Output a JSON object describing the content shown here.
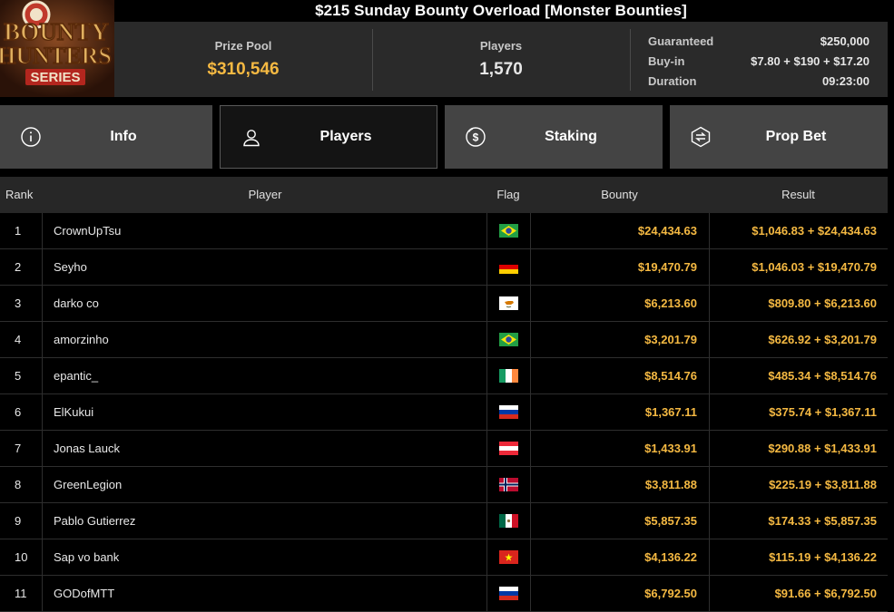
{
  "logo": {
    "line1": "BOUNTY",
    "line2": "HUNTERS",
    "line3": "SERIES"
  },
  "title": "$215 Sunday Bounty Overload [Monster Bounties]",
  "stats": {
    "prize_pool_label": "Prize Pool",
    "prize_pool_value": "$310,546",
    "players_label": "Players",
    "players_value": "1,570"
  },
  "details": [
    {
      "label": "Guaranteed",
      "value": "$250,000"
    },
    {
      "label": "Buy-in",
      "value": "$7.80 + $190 + $17.20"
    },
    {
      "label": "Duration",
      "value": "09:23:00"
    }
  ],
  "tabs": [
    {
      "label": "Info",
      "icon": "info-icon"
    },
    {
      "label": "Players",
      "icon": "user-icon",
      "active": true
    },
    {
      "label": "Staking",
      "icon": "dollar-coin-icon"
    },
    {
      "label": "Prop Bet",
      "icon": "bet-icon"
    }
  ],
  "table": {
    "headers": {
      "rank": "Rank",
      "player": "Player",
      "flag": "Flag",
      "bounty": "Bounty",
      "result": "Result"
    },
    "rows": [
      {
        "rank": "1",
        "player": "CrownUpTsu",
        "flag": "brazil",
        "bounty": "$24,434.63",
        "result": "$1,046.83 + $24,434.63"
      },
      {
        "rank": "2",
        "player": "Seyho",
        "flag": "germany",
        "bounty": "$19,470.79",
        "result": "$1,046.03 + $19,470.79"
      },
      {
        "rank": "3",
        "player": "darko co",
        "flag": "cyprus",
        "bounty": "$6,213.60",
        "result": "$809.80 + $6,213.60"
      },
      {
        "rank": "4",
        "player": "amorzinho",
        "flag": "brazil",
        "bounty": "$3,201.79",
        "result": "$626.92 + $3,201.79"
      },
      {
        "rank": "5",
        "player": "epantic_",
        "flag": "ireland",
        "bounty": "$8,514.76",
        "result": "$485.34 + $8,514.76"
      },
      {
        "rank": "6",
        "player": "ElKukui",
        "flag": "russia",
        "bounty": "$1,367.11",
        "result": "$375.74 + $1,367.11"
      },
      {
        "rank": "7",
        "player": "Jonas Lauck",
        "flag": "austria",
        "bounty": "$1,433.91",
        "result": "$290.88 + $1,433.91"
      },
      {
        "rank": "8",
        "player": "GreenLegion",
        "flag": "norway",
        "bounty": "$3,811.88",
        "result": "$225.19 + $3,811.88"
      },
      {
        "rank": "9",
        "player": "Pablo Gutierrez",
        "flag": "mexico",
        "bounty": "$5,857.35",
        "result": "$174.33 + $5,857.35"
      },
      {
        "rank": "10",
        "player": "Sap vo bank",
        "flag": "vietnam",
        "bounty": "$4,136.22",
        "result": "$115.19 + $4,136.22"
      },
      {
        "rank": "11",
        "player": "GODofMTT",
        "flag": "russia",
        "bounty": "$6,792.50",
        "result": "$91.66 + $6,792.50"
      }
    ]
  },
  "colors": {
    "gold": "#f5b942",
    "tab_bg": "#444444",
    "tab_active_bg": "#141414",
    "strip_bg": "#2a2a2a"
  }
}
